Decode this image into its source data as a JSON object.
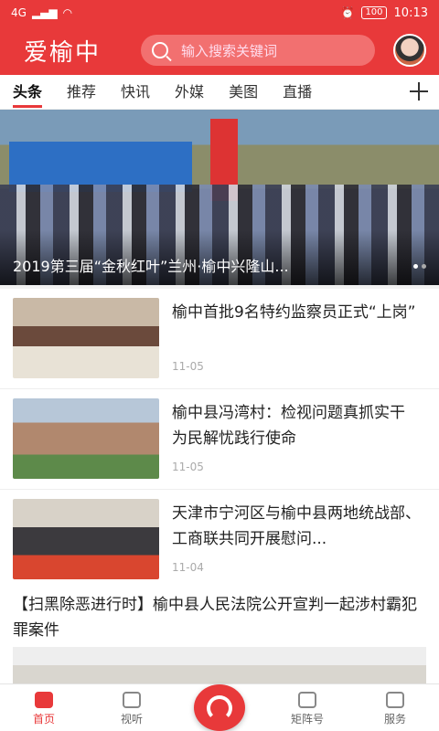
{
  "status": {
    "time": "10:13",
    "battery": "100",
    "network": "4G"
  },
  "app": {
    "title": "爱榆中"
  },
  "search": {
    "placeholder": "输入搜索关键词"
  },
  "tabs": [
    "头条",
    "推荐",
    "快讯",
    "外媒",
    "美图",
    "直播"
  ],
  "banner": {
    "title": "2019第三届“金秋红叶”兰州·榆中兴隆山..."
  },
  "articles": [
    {
      "title": "榆中首批9名特约监察员正式“上岗”",
      "date": "11-05"
    },
    {
      "title": "榆中县冯湾村：检视问题真抓实干 为民解忧践行使命",
      "date": "11-05"
    },
    {
      "title": "天津市宁河区与榆中县两地统战部、工商联共同开展慰问...",
      "date": "11-04"
    }
  ],
  "text_article": {
    "title": "【扫黑除恶进行时】榆中县人民法院公开宣判一起涉村霸犯罪案件"
  },
  "bottom_nav": [
    {
      "label": "首页",
      "icon": "home-icon"
    },
    {
      "label": "视听",
      "icon": "video-icon"
    },
    {
      "label": "",
      "icon": "broadcast-icon"
    },
    {
      "label": "矩阵号",
      "icon": "matrix-icon"
    },
    {
      "label": "服务",
      "icon": "service-icon"
    }
  ],
  "colors": {
    "accent": "#e8393a"
  }
}
